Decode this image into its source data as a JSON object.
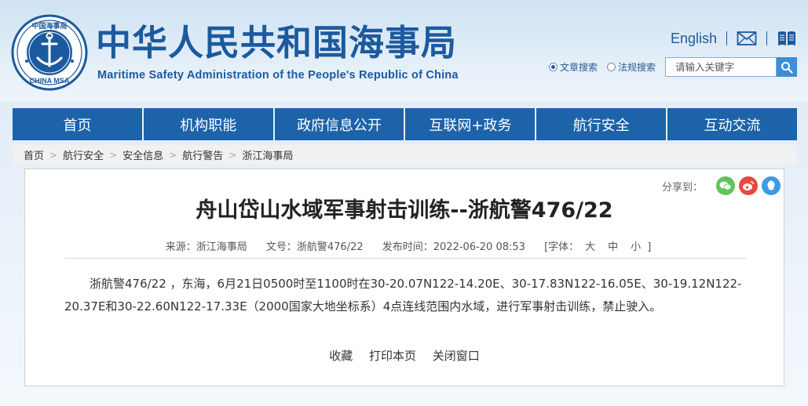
{
  "header": {
    "logo_text_top": "中国海事局",
    "logo_text_bottom": "CHINA MSA",
    "title": "中华人民共和国海事局",
    "subtitle": "Maritime Safety Administration of the People's Republic of China",
    "english_link": "English",
    "mail_icon": "mail-icon",
    "book_icon": "book-icon"
  },
  "search": {
    "option_article": "文章搜索",
    "option_law": "法规搜索",
    "selected": "文章搜索",
    "placeholder": "请输入关键字",
    "search_icon": "search-icon"
  },
  "nav": {
    "items": [
      "首页",
      "机构职能",
      "政府信息公开",
      "互联网+政务",
      "航行安全",
      "互动交流"
    ]
  },
  "breadcrumb": {
    "items": [
      "首页",
      "航行安全",
      "安全信息",
      "航行警告",
      "浙江海事局"
    ],
    "separator": ">"
  },
  "article": {
    "share_label": "分享到：",
    "share_icons": [
      "wechat-icon",
      "weibo-icon",
      "qq-icon"
    ],
    "title": "舟山岱山水域军事射击训练--浙航警476/22",
    "source": "来源：浙江海事局",
    "doc_no": "文号：浙航警476/22",
    "publish_time": "发布时间：2022-06-20 08:53",
    "font_label": "[字体：",
    "font_large": "大",
    "font_medium": "中",
    "font_small": "小",
    "font_close": "]",
    "body": "浙航警476/22 ，东海，6月21日0500时至1100时在30-20.07N122-14.20E、30-17.83N122-16.05E、30-19.12N122-20.37E和30-22.60N122-17.33E（2000国家大地坐标系）4点连线范围内水域，进行军事射击训练，禁止驶入。",
    "action_favorite": "收藏",
    "action_print": "打印本页",
    "action_close": "关闭窗口"
  },
  "colors": {
    "brand_blue": "#1c5a9e",
    "nav_blue": "#1d63a9",
    "search_button": "#3a8fd6",
    "wechat": "#5fc45a",
    "weibo": "#e8483f",
    "qq": "#3d9ae8"
  }
}
